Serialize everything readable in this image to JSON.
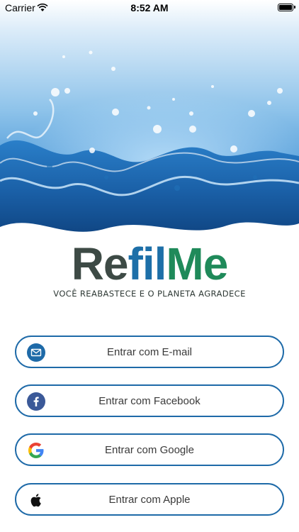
{
  "status_bar": {
    "carrier": "Carrier",
    "time": "8:52 AM"
  },
  "logo": {
    "part_a": "Re",
    "part_b": "fil",
    "part_c": "Me",
    "tagline": "VOCÊ REABASTECE E O PLANETA AGRADECE"
  },
  "buttons": {
    "email": {
      "label": "Entrar com E-mail",
      "icon": "envelope-icon"
    },
    "facebook": {
      "label": "Entrar com Facebook",
      "icon": "facebook-icon"
    },
    "google": {
      "label": "Entrar com Google",
      "icon": "google-icon"
    },
    "apple": {
      "label": "Entrar com Apple",
      "icon": "apple-icon"
    }
  },
  "colors": {
    "button_border": "#1e6aa8",
    "logo_dark": "#3d4a45",
    "logo_blue": "#1d6fa8",
    "logo_green": "#1f8a5a",
    "facebook_circle": "#3b5998",
    "email_circle": "#1e6aa8"
  }
}
